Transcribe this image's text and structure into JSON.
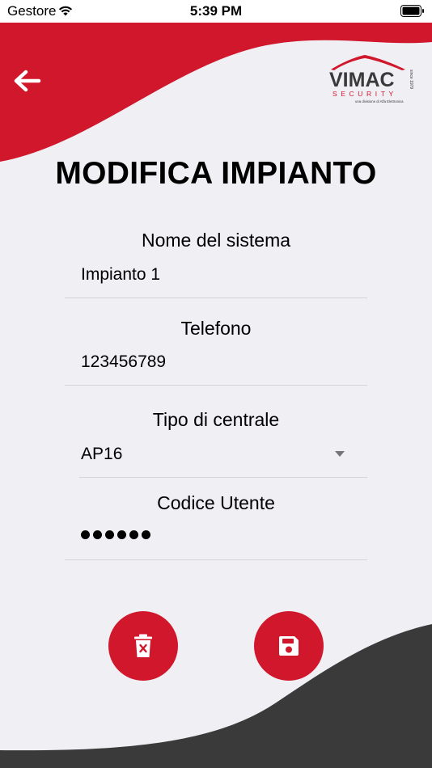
{
  "status_bar": {
    "carrier": "Gestore",
    "time": "5:39 PM"
  },
  "header": {
    "title": "MODIFICA IMPIANTO"
  },
  "logo": {
    "brand": "VIMAC",
    "tagline": "SECURITY",
    "since": "since 1979",
    "subtitle": "una divisione di Alfa Elettronica"
  },
  "form": {
    "system_name": {
      "label": "Nome del sistema",
      "value": "Impianto 1"
    },
    "phone": {
      "label": "Telefono",
      "value": "123456789"
    },
    "panel_type": {
      "label": "Tipo di centrale",
      "value": "AP16"
    },
    "user_code": {
      "label": "Codice Utente",
      "value_masked": "••••••"
    }
  },
  "actions": {
    "delete_icon": "trash-icon",
    "save_icon": "floppy-disk-icon"
  },
  "colors": {
    "accent": "#d0172c",
    "dark": "#3a3a3a",
    "background": "#efeff4"
  }
}
